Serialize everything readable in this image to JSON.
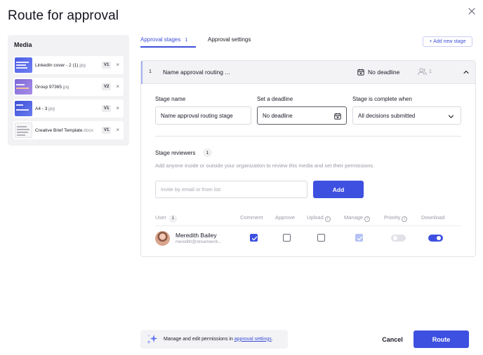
{
  "dialog": {
    "title": "Route for approval",
    "close_icon": "close-icon"
  },
  "media": {
    "heading": "Media",
    "items": [
      {
        "name": "LinkedIn cover - 2 (1)",
        "ext": ".jpg",
        "version": "V1",
        "thumb": "blue"
      },
      {
        "name": "Group 97365",
        "ext": ".jpg",
        "version": "V2",
        "thumb": "purple"
      },
      {
        "name": "A4 - 3",
        "ext": ".jpg",
        "version": "V1",
        "thumb": "blue2"
      },
      {
        "name": "Creative Brief Template",
        "ext": ".docx",
        "version": "V1",
        "thumb": "doc"
      }
    ],
    "remove_glyph": "×"
  },
  "tabs": {
    "stages_label": "Approval stages",
    "stages_count": "1",
    "settings_label": "Approval settings",
    "add_stage_label": "+ Add new stage"
  },
  "stage": {
    "number": "1",
    "title": "Name approval routing ...",
    "deadline_summary": "No deadline",
    "reviewers_count_summary": "1",
    "fields": {
      "name_label": "Stage name",
      "name_value": "Name approval routing stage",
      "deadline_label": "Set a deadline",
      "deadline_value": "No deadline",
      "complete_label": "Stage is complete when",
      "complete_value": "All decisions submitted"
    },
    "reviewers": {
      "label": "Stage reviewers",
      "count": "1",
      "description": "Add anyone inside or outside your organization to review this media and set their permissions.",
      "invite_placeholder": "Invite by email or from list",
      "add_label": "Add"
    },
    "columns": {
      "user": "User",
      "user_count": "1",
      "comment": "Comment",
      "approve": "Approve",
      "upload": "Upload",
      "manage": "Manage",
      "priority": "Priority",
      "download": "Download"
    },
    "rows": [
      {
        "name": "Meredith Bailey",
        "email": "meredith@streamwork...",
        "comment": true,
        "approve": false,
        "upload": false,
        "manage": true,
        "priority": false,
        "download": true
      }
    ]
  },
  "footer": {
    "note_prefix": "Manage and edit permissions in ",
    "note_link": "approval settings",
    "note_suffix": ".",
    "cancel_label": "Cancel",
    "route_label": "Route"
  },
  "colors": {
    "accent": "#3d50e0",
    "panel": "#f2f2f4"
  }
}
